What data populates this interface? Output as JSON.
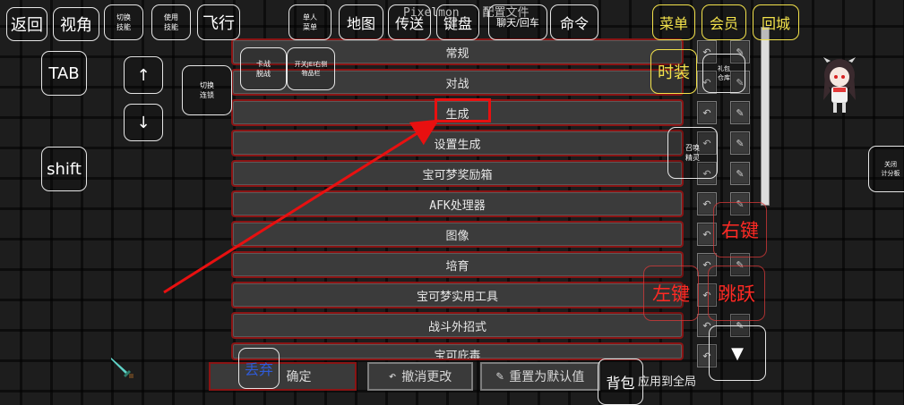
{
  "title": {
    "left_text": "Pixelmon",
    "right_text": "配置文件"
  },
  "config_rows": [
    {
      "label": "常规"
    },
    {
      "label": "对战"
    },
    {
      "label": "生成"
    },
    {
      "label": "设置生成"
    },
    {
      "label": "宝可梦奖励箱"
    },
    {
      "label": "AFK处理器"
    },
    {
      "label": "图像"
    },
    {
      "label": "培育"
    },
    {
      "label": "宝可梦实用工具"
    },
    {
      "label": "战斗外招式"
    },
    {
      "label": "宝可庇毒"
    }
  ],
  "row_side_icons": {
    "undo": "↶",
    "reset": "✎"
  },
  "bottom_bar": {
    "confirm": "确定",
    "undo_changes": "撤消更改",
    "undo_icon": "↶",
    "reset_default": "重置为默认值",
    "reset_icon": "✎",
    "apply_all": "应用到全局"
  },
  "controls": {
    "back": "返回",
    "view": "视角",
    "switch_skill": "切换\n技能",
    "use_skill": "使用\n技能",
    "fly": "飞行",
    "single_menu": "单人\n菜单",
    "map": "地图",
    "teleport": "传送",
    "hotbar": "键盘",
    "chat": "聊天/回车",
    "command": "命令",
    "menu": "菜单",
    "member": "会员",
    "return_city": "回城",
    "tab": "TAB",
    "arrow_up": "↑",
    "arrow_down": "↓",
    "card_battle": "卡战\n脱战",
    "jei_toggle": "开关JEI右侧\n物品栏",
    "switch_chain": "切换\n连锁",
    "shift": "shift",
    "fashion": "时装",
    "gift_box": "礼包\n仓库",
    "summon_spirit": "召唤\n精灵",
    "close_scoreboard": "关闭\n计分板",
    "right_click": "右键",
    "left_click": "左键",
    "jump": "跳跃",
    "down_triangle": "▼",
    "drop": "丢弃",
    "backpack": "背包"
  },
  "colors": {
    "highlight_red": "#e81010",
    "arrow_red": "#e81010",
    "control_yellow": "#f3e24b",
    "control_red_text": "#ff2a24",
    "drop_blue": "#2f5bd8",
    "row_border": "#8a1414"
  }
}
